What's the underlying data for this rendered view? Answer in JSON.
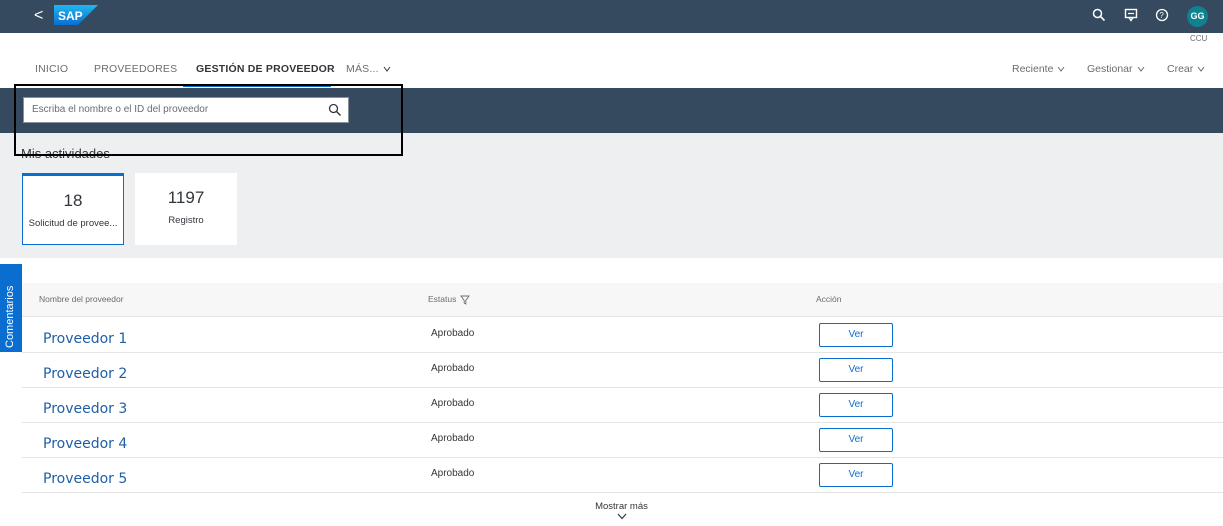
{
  "shell": {
    "back_glyph": "<",
    "logo_text": "SAP",
    "actions": [
      "search-icon",
      "feedback-icon",
      "help-icon"
    ],
    "avatar_initials": "GG",
    "company": "CCU"
  },
  "tabs": {
    "items": [
      {
        "label": "INICIO"
      },
      {
        "label": "PROVEEDORES"
      },
      {
        "label": "GESTIÓN DE PROVEEDOR"
      },
      {
        "label": "MÁS..."
      }
    ],
    "active": "GESTIÓN DE PROVEEDOR",
    "right": [
      {
        "label": "Reciente"
      },
      {
        "label": "Gestionar"
      },
      {
        "label": "Crear"
      }
    ]
  },
  "search": {
    "placeholder": "Escriba el nombre o el ID del proveedor"
  },
  "activities": {
    "title": "Mis actividades",
    "tiles": [
      {
        "value": "18",
        "label": "Solicitud de provee..."
      },
      {
        "value": "1197",
        "label": "Registro"
      }
    ]
  },
  "side_tab": {
    "label": "Comentarios"
  },
  "table": {
    "columns": [
      "Nombre del proveedor",
      "Estatus",
      "Acción"
    ],
    "rows": [
      {
        "name": "Proveedor 1",
        "status": "Aprobado",
        "action": "Ver"
      },
      {
        "name": "Proveedor 2",
        "status": "Aprobado",
        "action": "Ver"
      },
      {
        "name": "Proveedor 3",
        "status": "Aprobado",
        "action": "Ver"
      },
      {
        "name": "Proveedor 4",
        "status": "Aprobado",
        "action": "Ver"
      },
      {
        "name": "Proveedor 5",
        "status": "Aprobado",
        "action": "Ver"
      }
    ],
    "show_more": "Mostrar más"
  },
  "colors": {
    "shell": "#354a5f",
    "accent": "#0a6ed1",
    "avatar": "#0f828f",
    "activities_bg": "#edeff0"
  }
}
